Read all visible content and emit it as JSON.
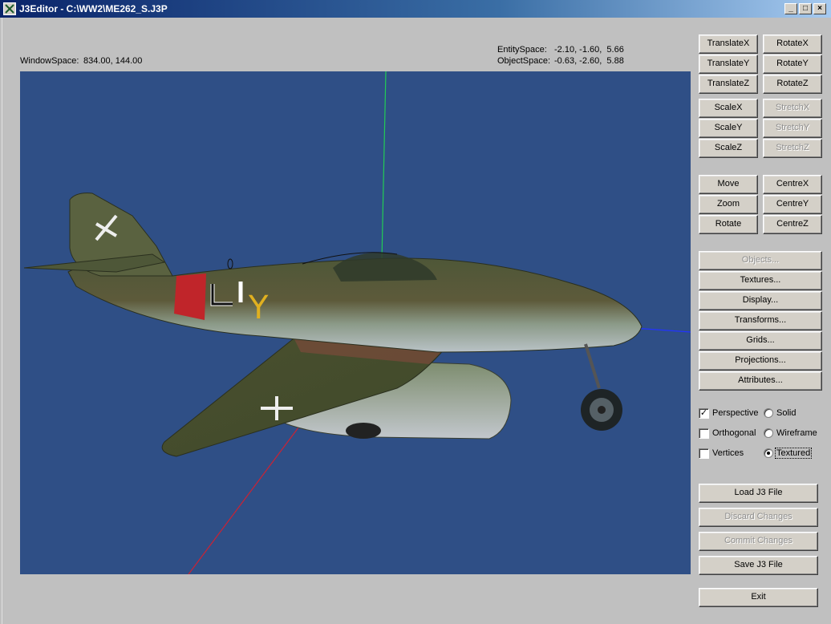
{
  "window": {
    "title": "J3Editor - C:\\WW2\\ME262_S.J3P",
    "minimize_glyph": "_",
    "maximize_glyph": "□",
    "close_glyph": "×"
  },
  "readouts": {
    "window_space_label": "WindowSpace:",
    "window_space_value": "834.00, 144.00",
    "entity_space_label": "EntitySpace:",
    "entity_space_value": "-2.10, -1.60,  5.66",
    "object_space_label": "ObjectSpace:",
    "object_space_value": "-0.63, -2.60,  5.88"
  },
  "transform_buttons": {
    "translate_x": "TranslateX",
    "translate_y": "TranslateY",
    "translate_z": "TranslateZ",
    "rotate_x": "RotateX",
    "rotate_y": "RotateY",
    "rotate_z": "RotateZ",
    "scale_x": "ScaleX",
    "scale_y": "ScaleY",
    "scale_z": "ScaleZ",
    "stretch_x": "StretchX",
    "stretch_y": "StretchY",
    "stretch_z": "StretchZ"
  },
  "view_buttons": {
    "move": "Move",
    "zoom": "Zoom",
    "rotate": "Rotate",
    "centre_x": "CentreX",
    "centre_y": "CentreY",
    "centre_z": "CentreZ"
  },
  "menu_buttons": {
    "objects": "Objects...",
    "textures": "Textures...",
    "display": "Display...",
    "transforms": "Transforms...",
    "grids": "Grids...",
    "projections": "Projections...",
    "attributes": "Attributes..."
  },
  "options": {
    "perspective": {
      "label": "Perspective",
      "checked": true
    },
    "orthogonal": {
      "label": "Orthogonal",
      "checked": false
    },
    "vertices": {
      "label": "Vertices",
      "checked": false
    },
    "solid": {
      "label": "Solid",
      "selected": false
    },
    "wireframe": {
      "label": "Wireframe",
      "selected": false
    },
    "textured": {
      "label": "Textured",
      "selected": true
    }
  },
  "file_buttons": {
    "load": "Load J3 File",
    "discard": "Discard Changes",
    "commit": "Commit Changes",
    "save": "Save J3 File",
    "exit": "Exit"
  },
  "colors": {
    "viewport_bg": "#2f4f86",
    "axis_y": "#22cc55",
    "axis_x": "#2233ff",
    "axis_z": "#cc2233"
  }
}
